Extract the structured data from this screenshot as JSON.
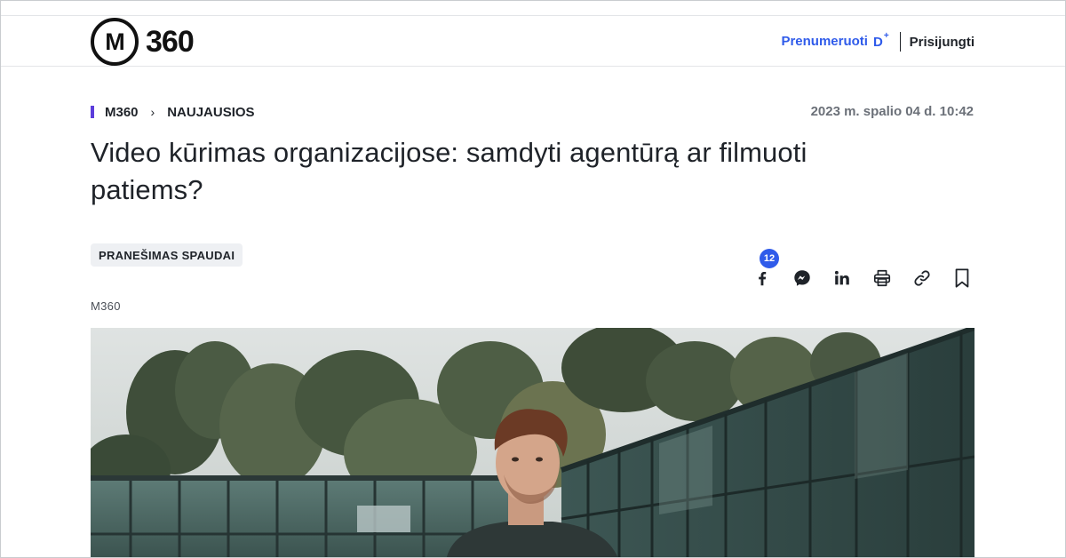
{
  "header": {
    "logo_mark": "M",
    "logo_text": "360",
    "subscribe_label": "Prenumeruoti",
    "subscribe_brand": "D",
    "subscribe_plus": "+",
    "login_label": "Prisijungti"
  },
  "breadcrumb": {
    "items": [
      "M360",
      "NAUJAUSIOS"
    ],
    "separator": "›"
  },
  "article": {
    "date": "2023 m. spalio 04 d. 10:42",
    "title": "Video kūrimas organizacijose: samdyti agentūrą ar filmuoti patiems?",
    "tag": "PRANEŠIMAS SPAUDAI",
    "author": "M360"
  },
  "share": {
    "facebook_count": "12",
    "icons": [
      "facebook-icon",
      "messenger-icon",
      "linkedin-icon",
      "print-icon",
      "link-icon",
      "bookmark-icon"
    ]
  },
  "colors": {
    "accent": "#2f5bea",
    "breadcrumb_mark": "#5b3ddb",
    "text": "#1f2329",
    "muted": "#6b7078"
  }
}
